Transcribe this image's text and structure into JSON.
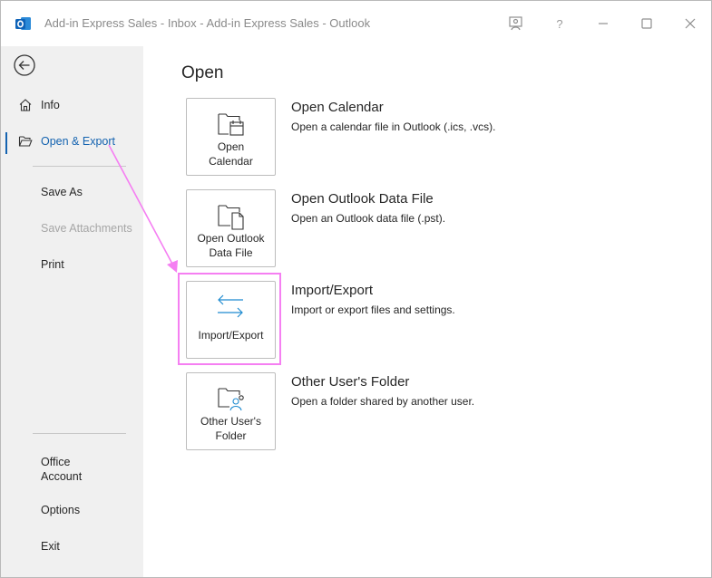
{
  "titlebar": {
    "title": "Add-in Express Sales - Inbox - Add-in Express Sales  -  Outlook",
    "app_icon": "outlook-icon",
    "buttons": [
      "coach-icon",
      "help-icon",
      "minimize-icon",
      "maximize-icon",
      "close-icon"
    ],
    "help_label": "?"
  },
  "sidebar": {
    "back_icon": "back-arrow-icon",
    "items": [
      {
        "label": "Info",
        "icon": "home-icon"
      },
      {
        "label": "Open & Export",
        "icon": "folder-open-icon",
        "active": true
      },
      {
        "label": "Save As"
      },
      {
        "label": "Save Attachments",
        "disabled": true
      },
      {
        "label": "Print"
      },
      {
        "label": "Office\nAccount"
      },
      {
        "label": "Options"
      },
      {
        "label": "Exit"
      }
    ]
  },
  "main": {
    "title": "Open",
    "options": [
      {
        "tile_label": "Open\nCalendar",
        "title": "Open Calendar",
        "description": "Open a calendar file in Outlook (.ics, .vcs).",
        "icon": "folder-calendar-icon"
      },
      {
        "tile_label": "Open Outlook\nData File",
        "title": "Open Outlook Data File",
        "description": "Open an Outlook data file (.pst).",
        "icon": "folder-file-icon"
      },
      {
        "tile_label": "Import/Export",
        "title": "Import/Export",
        "description": "Import or export files and settings.",
        "icon": "import-export-icon",
        "highlighted": true
      },
      {
        "tile_label": "Other User's\nFolder",
        "title": "Other User's Folder",
        "description": "Open a folder shared by another user.",
        "icon": "shared-folder-icon"
      }
    ]
  },
  "colors": {
    "accent": "#1463b0",
    "highlight": "#f57ff2",
    "sidebar_bg": "#f0f0f0"
  }
}
